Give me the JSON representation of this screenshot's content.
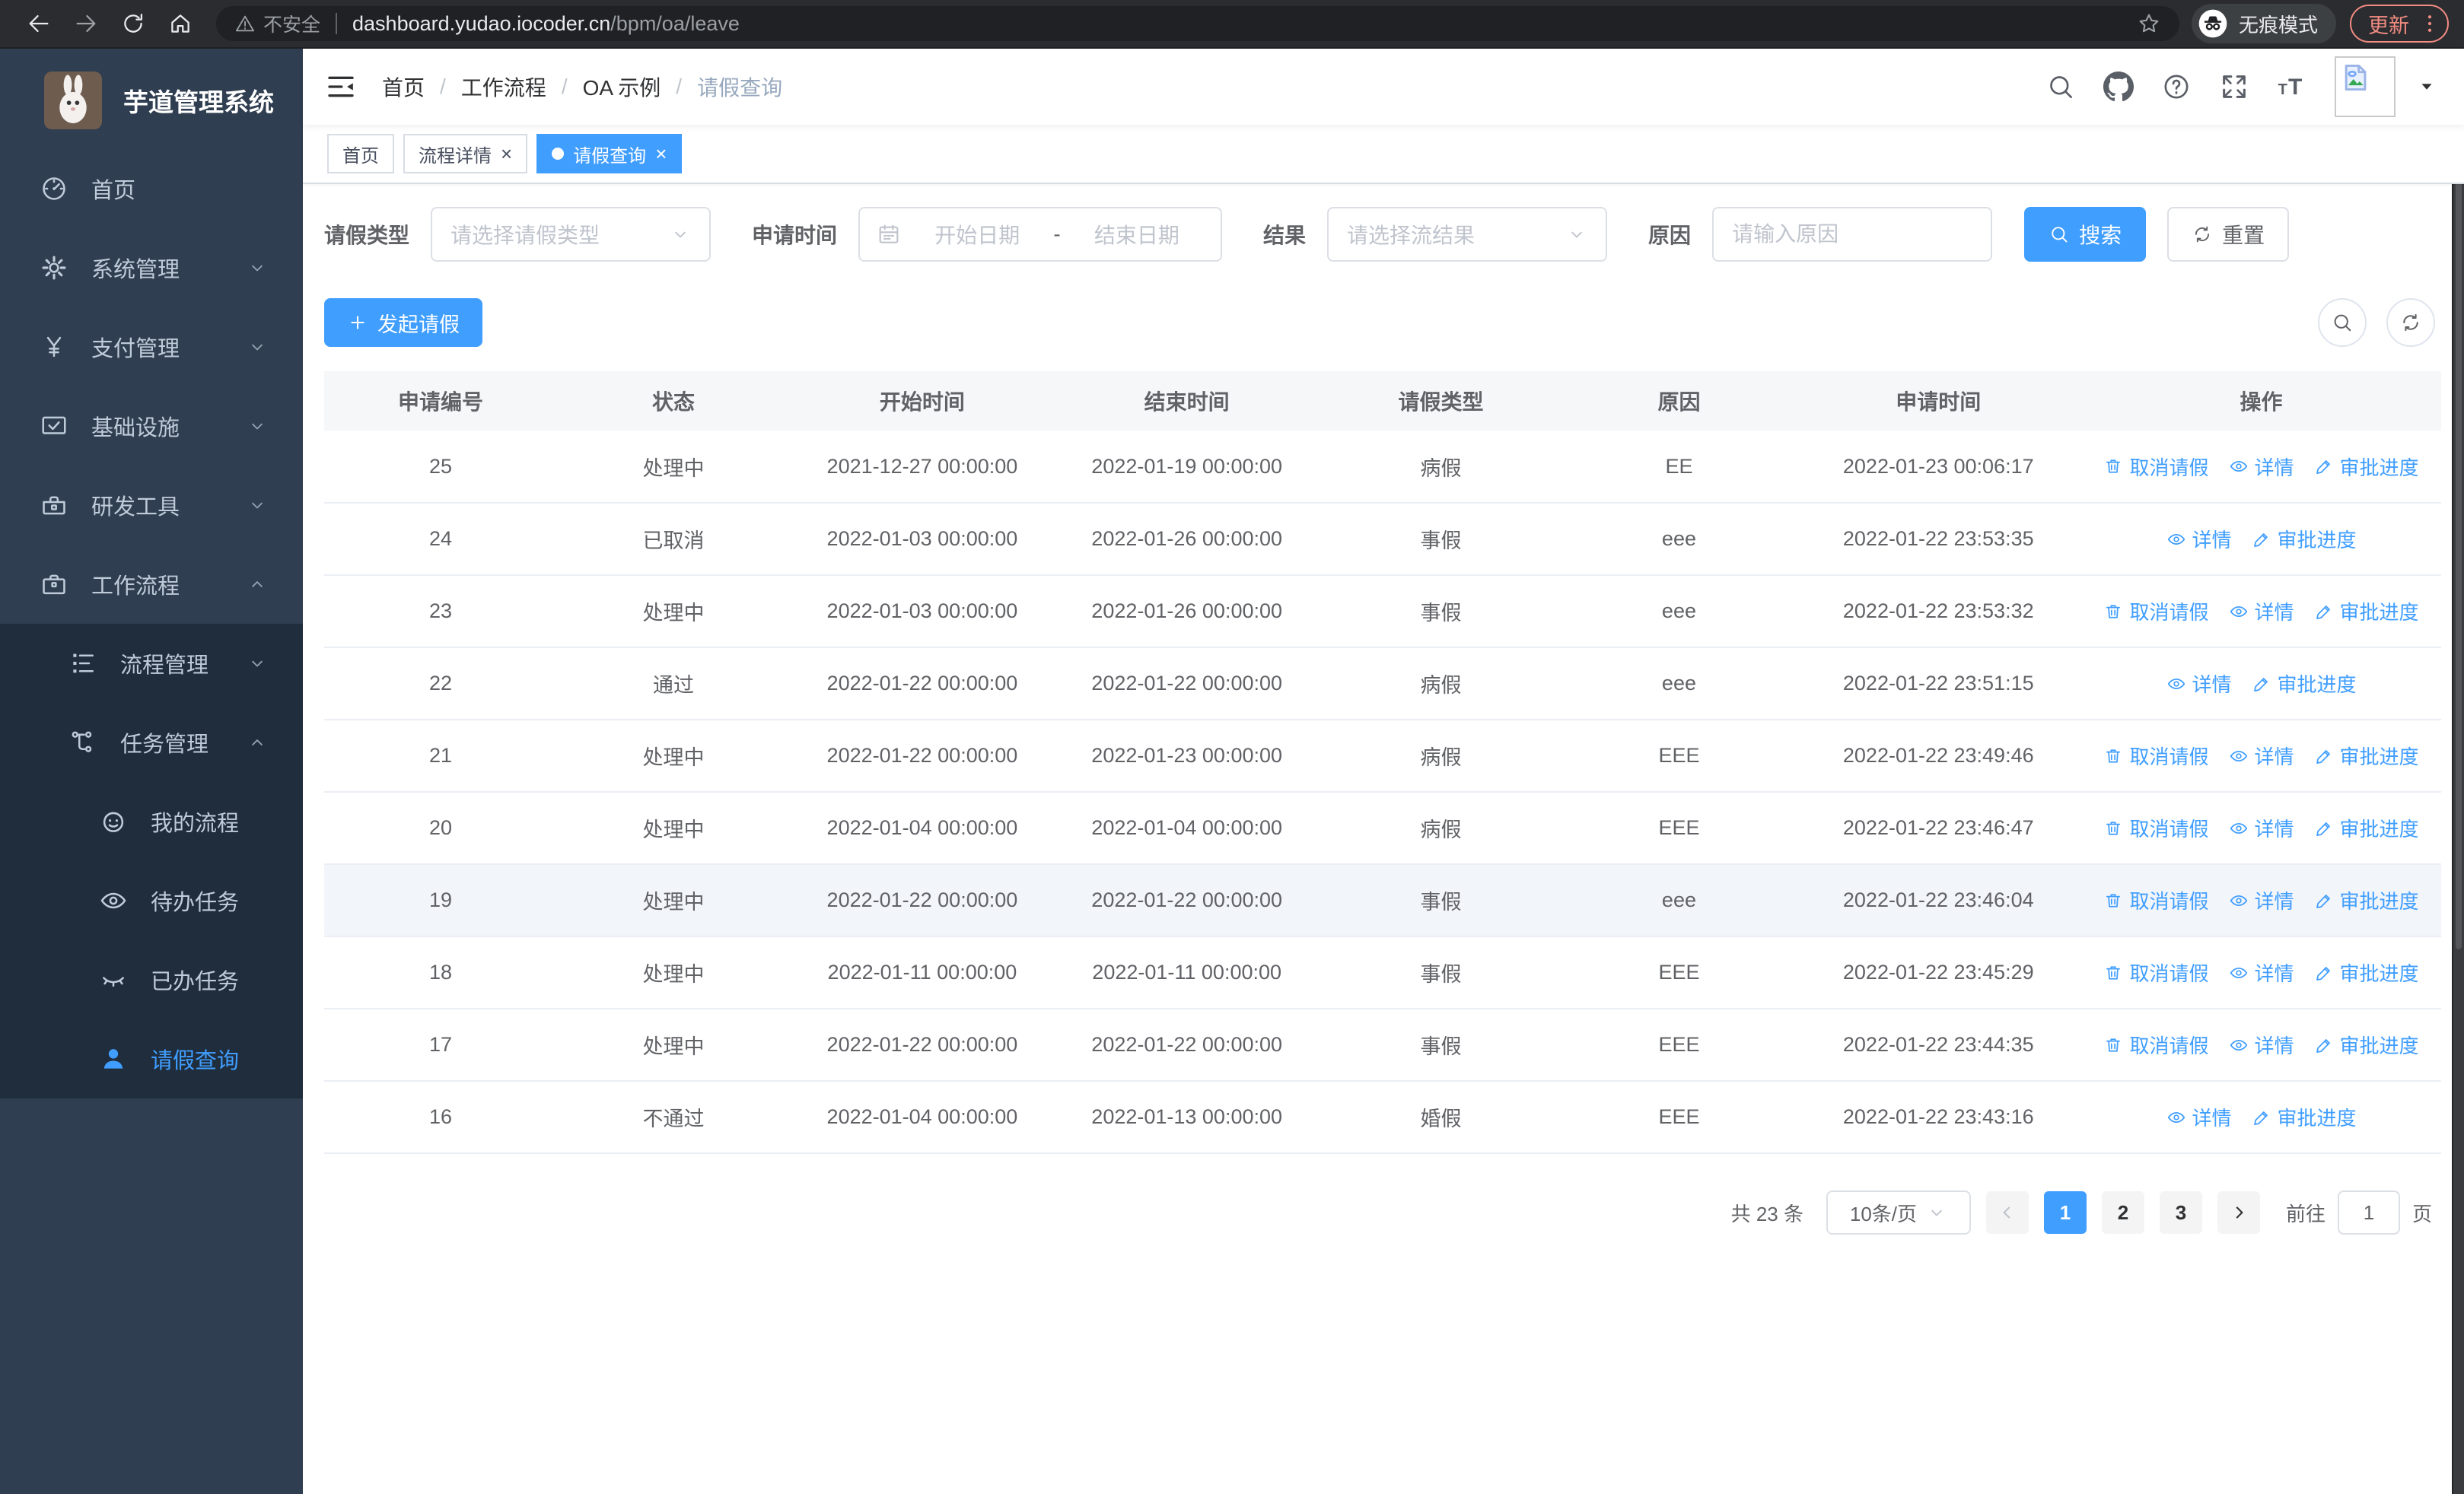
{
  "colors": {
    "accent": "#409eff",
    "sidebar_bg": "#2f3e50",
    "submenu_bg": "#1f2d3d",
    "sidebar_text": "#bfcbd9",
    "update_button": "#f28b82",
    "link": "#409eff",
    "table_header_bg": "#f6f7f9",
    "highlight_row_bg": "#f2f5fa"
  },
  "browser": {
    "security_label": "不安全",
    "url_host": "dashboard.yudao.iocoder.cn",
    "url_path": "/bpm/oa/leave",
    "incognito_label": "无痕模式",
    "update_label": "更新"
  },
  "sidebar": {
    "title": "芋道管理系统",
    "menu": [
      {
        "name": "home",
        "label": "首页",
        "icon": "gauge-icon",
        "level": 1
      },
      {
        "name": "system",
        "label": "系统管理",
        "icon": "gear-icon",
        "level": 1,
        "chevron": "down"
      },
      {
        "name": "payment",
        "label": "支付管理",
        "icon": "yen-icon",
        "level": 1,
        "chevron": "down"
      },
      {
        "name": "infrastructure",
        "label": "基础设施",
        "icon": "monitor-icon",
        "level": 1,
        "chevron": "down"
      },
      {
        "name": "devtools",
        "label": "研发工具",
        "icon": "toolbox-icon",
        "level": 1,
        "chevron": "down"
      },
      {
        "name": "workflow",
        "label": "工作流程",
        "icon": "briefcase-icon",
        "level": 1,
        "chevron": "up"
      },
      {
        "name": "process-mgmt",
        "label": "流程管理",
        "icon": "stream-icon",
        "level": 2,
        "chevron": "down"
      },
      {
        "name": "task-mgmt",
        "label": "任务管理",
        "icon": "tree-icon",
        "level": 2,
        "chevron": "up"
      },
      {
        "name": "my-process",
        "label": "我的流程",
        "icon": "robot-icon",
        "level": 3
      },
      {
        "name": "todo-task",
        "label": "待办任务",
        "icon": "eye-icon",
        "level": 3
      },
      {
        "name": "done-task",
        "label": "已办任务",
        "icon": "eye-closed-icon",
        "level": 3
      },
      {
        "name": "leave-query",
        "label": "请假查询",
        "icon": "user-icon",
        "level": 3,
        "active": true
      }
    ]
  },
  "header": {
    "breadcrumb": [
      "首页",
      "工作流程",
      "OA 示例",
      "请假查询"
    ]
  },
  "tabs": [
    {
      "name": "home",
      "label": "首页",
      "closable": false,
      "active": false
    },
    {
      "name": "process-detail",
      "label": "流程详情",
      "closable": true,
      "active": false
    },
    {
      "name": "leave-query",
      "label": "请假查询",
      "closable": true,
      "active": true
    }
  ],
  "filters": {
    "leave_type": {
      "label": "请假类型",
      "placeholder": "请选择请假类型"
    },
    "apply_time": {
      "label": "申请时间",
      "start_placeholder": "开始日期",
      "separator": "-",
      "end_placeholder": "结束日期"
    },
    "result": {
      "label": "结果",
      "placeholder": "请选择流结果"
    },
    "reason": {
      "label": "原因",
      "placeholder": "请输入原因"
    },
    "search_label": "搜索",
    "reset_label": "重置"
  },
  "toolbar": {
    "create_label": "发起请假"
  },
  "table": {
    "columns": [
      "申请编号",
      "状态",
      "开始时间",
      "结束时间",
      "请假类型",
      "原因",
      "申请时间",
      "操作"
    ],
    "column_keys": [
      "id",
      "status",
      "start_time",
      "end_time",
      "leave_type",
      "reason",
      "apply_time",
      "ops"
    ],
    "action_labels": {
      "cancel": "取消请假",
      "detail": "详情",
      "progress": "审批进度"
    },
    "rows": [
      {
        "id": "25",
        "status": "处理中",
        "start_time": "2021-12-27 00:00:00",
        "end_time": "2022-01-19 00:00:00",
        "leave_type": "病假",
        "reason": "EE",
        "apply_time": "2022-01-23 00:06:17",
        "actions": [
          "cancel",
          "detail",
          "progress"
        ]
      },
      {
        "id": "24",
        "status": "已取消",
        "start_time": "2022-01-03 00:00:00",
        "end_time": "2022-01-26 00:00:00",
        "leave_type": "事假",
        "reason": "eee",
        "apply_time": "2022-01-22 23:53:35",
        "actions": [
          "detail",
          "progress"
        ]
      },
      {
        "id": "23",
        "status": "处理中",
        "start_time": "2022-01-03 00:00:00",
        "end_time": "2022-01-26 00:00:00",
        "leave_type": "事假",
        "reason": "eee",
        "apply_time": "2022-01-22 23:53:32",
        "actions": [
          "cancel",
          "detail",
          "progress"
        ]
      },
      {
        "id": "22",
        "status": "通过",
        "start_time": "2022-01-22 00:00:00",
        "end_time": "2022-01-22 00:00:00",
        "leave_type": "病假",
        "reason": "eee",
        "apply_time": "2022-01-22 23:51:15",
        "actions": [
          "detail",
          "progress"
        ]
      },
      {
        "id": "21",
        "status": "处理中",
        "start_time": "2022-01-22 00:00:00",
        "end_time": "2022-01-23 00:00:00",
        "leave_type": "病假",
        "reason": "EEE",
        "apply_time": "2022-01-22 23:49:46",
        "actions": [
          "cancel",
          "detail",
          "progress"
        ]
      },
      {
        "id": "20",
        "status": "处理中",
        "start_time": "2022-01-04 00:00:00",
        "end_time": "2022-01-04 00:00:00",
        "leave_type": "病假",
        "reason": "EEE",
        "apply_time": "2022-01-22 23:46:47",
        "actions": [
          "cancel",
          "detail",
          "progress"
        ]
      },
      {
        "id": "19",
        "status": "处理中",
        "start_time": "2022-01-22 00:00:00",
        "end_time": "2022-01-22 00:00:00",
        "leave_type": "事假",
        "reason": "eee",
        "apply_time": "2022-01-22 23:46:04",
        "actions": [
          "cancel",
          "detail",
          "progress"
        ],
        "highlighted": true
      },
      {
        "id": "18",
        "status": "处理中",
        "start_time": "2022-01-11 00:00:00",
        "end_time": "2022-01-11 00:00:00",
        "leave_type": "事假",
        "reason": "EEE",
        "apply_time": "2022-01-22 23:45:29",
        "actions": [
          "cancel",
          "detail",
          "progress"
        ]
      },
      {
        "id": "17",
        "status": "处理中",
        "start_time": "2022-01-22 00:00:00",
        "end_time": "2022-01-22 00:00:00",
        "leave_type": "事假",
        "reason": "EEE",
        "apply_time": "2022-01-22 23:44:35",
        "actions": [
          "cancel",
          "detail",
          "progress"
        ]
      },
      {
        "id": "16",
        "status": "不通过",
        "start_time": "2022-01-04 00:00:00",
        "end_time": "2022-01-13 00:00:00",
        "leave_type": "婚假",
        "reason": "EEE",
        "apply_time": "2022-01-22 23:43:16",
        "actions": [
          "detail",
          "progress"
        ]
      }
    ]
  },
  "pagination": {
    "total_label": "共 23 条",
    "page_size_label": "10条/页",
    "pages": [
      "1",
      "2",
      "3"
    ],
    "current": "1",
    "goto_label": "前往",
    "goto_value": "1",
    "page_unit": "页"
  }
}
